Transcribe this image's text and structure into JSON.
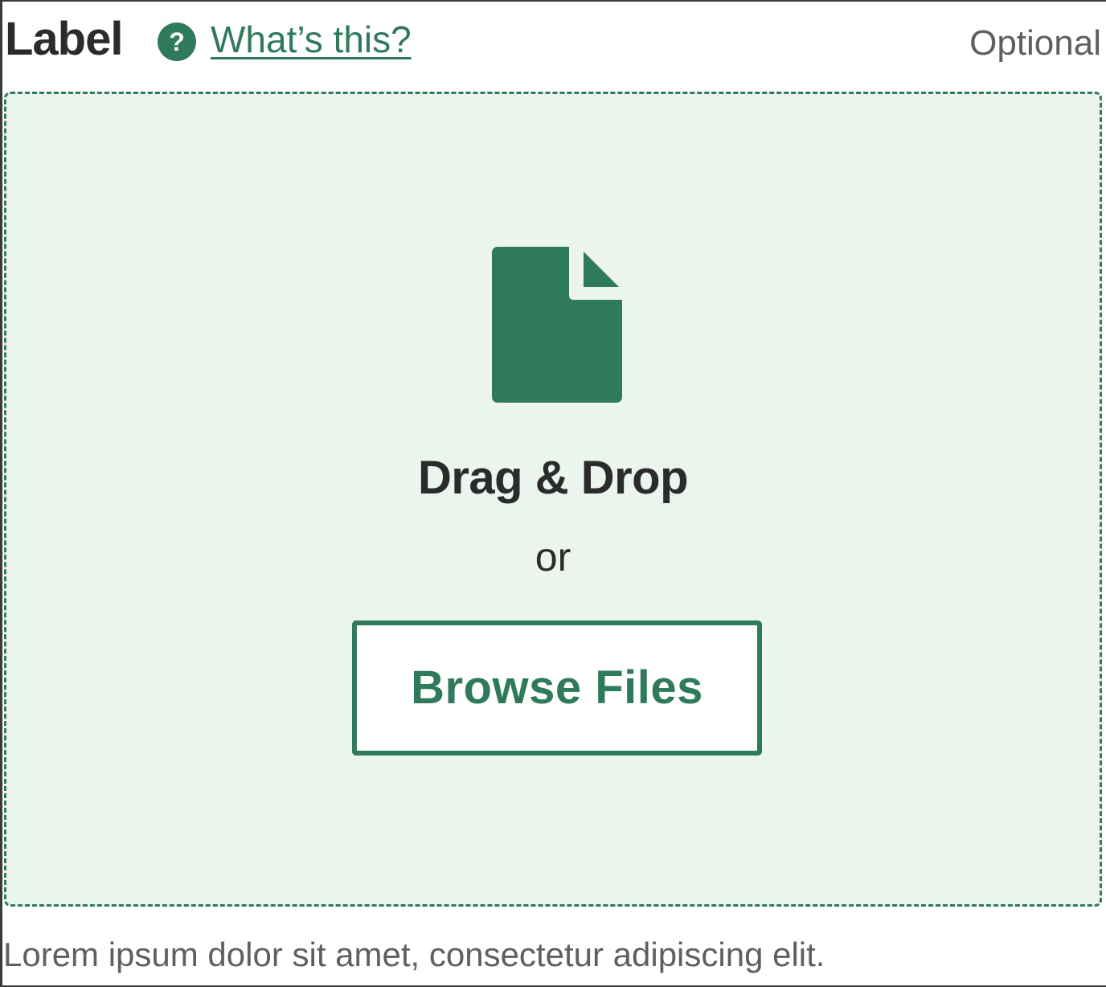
{
  "field": {
    "label": "Label",
    "help_icon_glyph": "?",
    "help_link": "What’s this?",
    "optional": "Optional",
    "hint": "Lorem ipsum dolor sit amet, consectetur adipiscing elit."
  },
  "dropzone": {
    "icon": "file-icon",
    "title": "Drag & Drop",
    "or": "or",
    "browse_label": "Browse Files"
  },
  "colors": {
    "accent": "#2f7a5b",
    "dropzone_bg": "#ebf5ee",
    "text": "#2b2b2b",
    "muted": "#5f5f5f"
  }
}
